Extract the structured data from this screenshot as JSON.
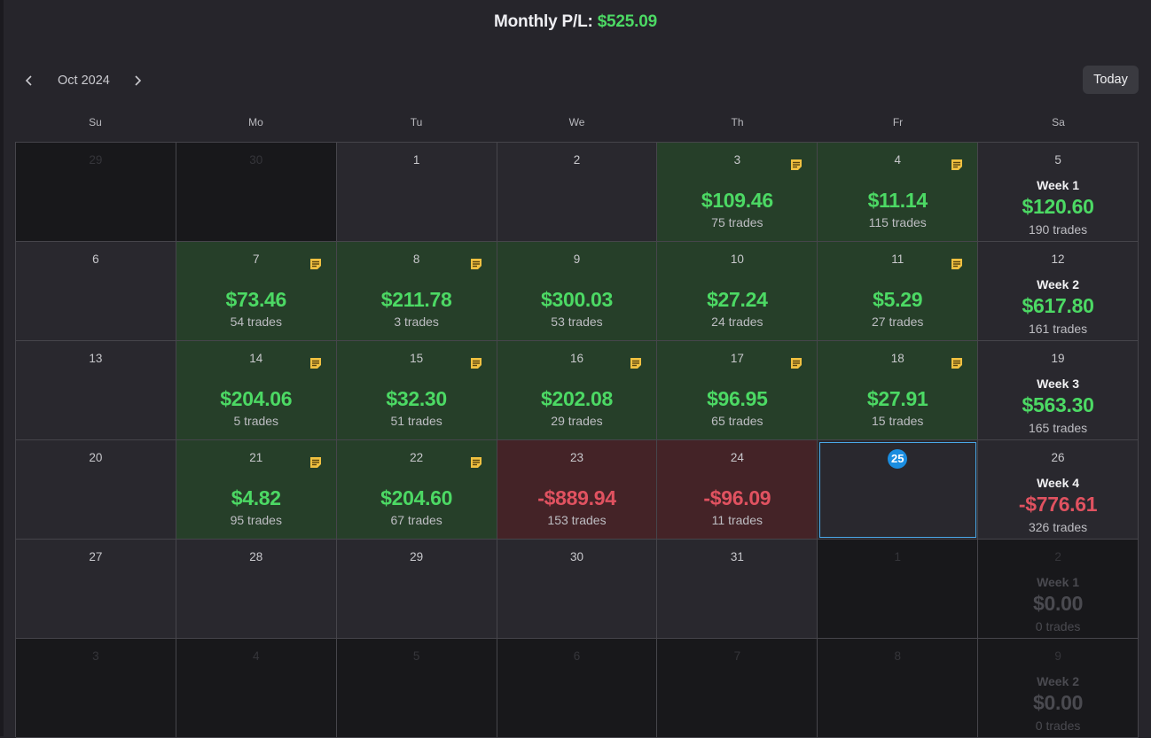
{
  "header": {
    "prefix": "Monthly P/L: ",
    "value": "$525.09"
  },
  "nav": {
    "month": "Oct 2024",
    "today": "Today"
  },
  "weekdays": [
    "Su",
    "Mo",
    "Tu",
    "We",
    "Th",
    "Fr",
    "Sa"
  ],
  "colors": {
    "profit": "#4cd964",
    "loss": "#e05260",
    "note": "#f0c040",
    "today": "#1a8de0"
  },
  "weeks": [
    [
      {
        "day": "29",
        "other": true
      },
      {
        "day": "30",
        "other": true
      },
      {
        "day": "1"
      },
      {
        "day": "2"
      },
      {
        "day": "3",
        "pl": "$109.46",
        "trades": "75 trades",
        "status": "win",
        "note": true
      },
      {
        "day": "4",
        "pl": "$11.14",
        "trades": "115 trades",
        "status": "win",
        "note": true
      },
      {
        "day": "5",
        "summary": true,
        "week": "Week 1",
        "pl": "$120.60",
        "trades": "190 trades"
      }
    ],
    [
      {
        "day": "6"
      },
      {
        "day": "7",
        "pl": "$73.46",
        "trades": "54 trades",
        "status": "win",
        "note": true
      },
      {
        "day": "8",
        "pl": "$211.78",
        "trades": "3 trades",
        "status": "win",
        "note": true
      },
      {
        "day": "9",
        "pl": "$300.03",
        "trades": "53 trades",
        "status": "win"
      },
      {
        "day": "10",
        "pl": "$27.24",
        "trades": "24 trades",
        "status": "win"
      },
      {
        "day": "11",
        "pl": "$5.29",
        "trades": "27 trades",
        "status": "win",
        "note": true
      },
      {
        "day": "12",
        "summary": true,
        "week": "Week 2",
        "pl": "$617.80",
        "trades": "161 trades"
      }
    ],
    [
      {
        "day": "13"
      },
      {
        "day": "14",
        "pl": "$204.06",
        "trades": "5 trades",
        "status": "win",
        "note": true
      },
      {
        "day": "15",
        "pl": "$32.30",
        "trades": "51 trades",
        "status": "win",
        "note": true
      },
      {
        "day": "16",
        "pl": "$202.08",
        "trades": "29 trades",
        "status": "win",
        "note": true
      },
      {
        "day": "17",
        "pl": "$96.95",
        "trades": "65 trades",
        "status": "win",
        "note": true
      },
      {
        "day": "18",
        "pl": "$27.91",
        "trades": "15 trades",
        "status": "win",
        "note": true
      },
      {
        "day": "19",
        "summary": true,
        "week": "Week 3",
        "pl": "$563.30",
        "trades": "165 trades"
      }
    ],
    [
      {
        "day": "20"
      },
      {
        "day": "21",
        "pl": "$4.82",
        "trades": "95 trades",
        "status": "win",
        "note": true
      },
      {
        "day": "22",
        "pl": "$204.60",
        "trades": "67 trades",
        "status": "win",
        "note": true
      },
      {
        "day": "23",
        "pl": "-$889.94",
        "trades": "153 trades",
        "status": "loss"
      },
      {
        "day": "24",
        "pl": "-$96.09",
        "trades": "11 trades",
        "status": "loss"
      },
      {
        "day": "25",
        "today": true
      },
      {
        "day": "26",
        "summary": true,
        "week": "Week 4",
        "pl": "-$776.61",
        "trades": "326 trades",
        "neg": true
      }
    ],
    [
      {
        "day": "27"
      },
      {
        "day": "28"
      },
      {
        "day": "29"
      },
      {
        "day": "30"
      },
      {
        "day": "31"
      },
      {
        "day": "1",
        "other": true
      },
      {
        "day": "2",
        "summary": true,
        "dim": true,
        "other": true,
        "week": "Week 1",
        "pl": "$0.00",
        "trades": "0 trades"
      }
    ],
    [
      {
        "day": "3",
        "other": true
      },
      {
        "day": "4",
        "other": true
      },
      {
        "day": "5",
        "other": true
      },
      {
        "day": "6",
        "other": true
      },
      {
        "day": "7",
        "other": true
      },
      {
        "day": "8",
        "other": true
      },
      {
        "day": "9",
        "summary": true,
        "dim": true,
        "other": true,
        "week": "Week 2",
        "pl": "$0.00",
        "trades": "0 trades"
      }
    ]
  ]
}
